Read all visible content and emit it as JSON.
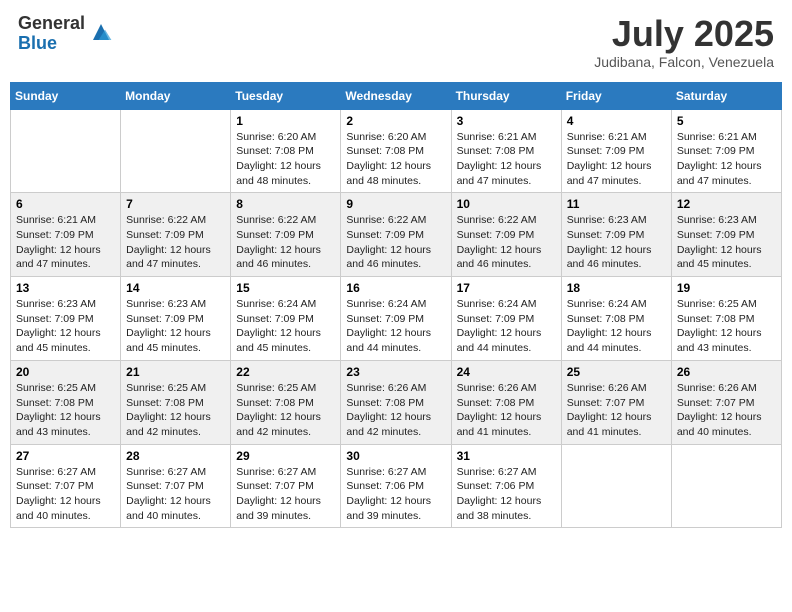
{
  "logo": {
    "general": "General",
    "blue": "Blue"
  },
  "header": {
    "title": "July 2025",
    "location": "Judibana, Falcon, Venezuela"
  },
  "days_of_week": [
    "Sunday",
    "Monday",
    "Tuesday",
    "Wednesday",
    "Thursday",
    "Friday",
    "Saturday"
  ],
  "weeks": [
    [
      {
        "day": "",
        "info": ""
      },
      {
        "day": "",
        "info": ""
      },
      {
        "day": "1",
        "info": "Sunrise: 6:20 AM\nSunset: 7:08 PM\nDaylight: 12 hours and 48 minutes."
      },
      {
        "day": "2",
        "info": "Sunrise: 6:20 AM\nSunset: 7:08 PM\nDaylight: 12 hours and 48 minutes."
      },
      {
        "day": "3",
        "info": "Sunrise: 6:21 AM\nSunset: 7:08 PM\nDaylight: 12 hours and 47 minutes."
      },
      {
        "day": "4",
        "info": "Sunrise: 6:21 AM\nSunset: 7:09 PM\nDaylight: 12 hours and 47 minutes."
      },
      {
        "day": "5",
        "info": "Sunrise: 6:21 AM\nSunset: 7:09 PM\nDaylight: 12 hours and 47 minutes."
      }
    ],
    [
      {
        "day": "6",
        "info": "Sunrise: 6:21 AM\nSunset: 7:09 PM\nDaylight: 12 hours and 47 minutes."
      },
      {
        "day": "7",
        "info": "Sunrise: 6:22 AM\nSunset: 7:09 PM\nDaylight: 12 hours and 47 minutes."
      },
      {
        "day": "8",
        "info": "Sunrise: 6:22 AM\nSunset: 7:09 PM\nDaylight: 12 hours and 46 minutes."
      },
      {
        "day": "9",
        "info": "Sunrise: 6:22 AM\nSunset: 7:09 PM\nDaylight: 12 hours and 46 minutes."
      },
      {
        "day": "10",
        "info": "Sunrise: 6:22 AM\nSunset: 7:09 PM\nDaylight: 12 hours and 46 minutes."
      },
      {
        "day": "11",
        "info": "Sunrise: 6:23 AM\nSunset: 7:09 PM\nDaylight: 12 hours and 46 minutes."
      },
      {
        "day": "12",
        "info": "Sunrise: 6:23 AM\nSunset: 7:09 PM\nDaylight: 12 hours and 45 minutes."
      }
    ],
    [
      {
        "day": "13",
        "info": "Sunrise: 6:23 AM\nSunset: 7:09 PM\nDaylight: 12 hours and 45 minutes."
      },
      {
        "day": "14",
        "info": "Sunrise: 6:23 AM\nSunset: 7:09 PM\nDaylight: 12 hours and 45 minutes."
      },
      {
        "day": "15",
        "info": "Sunrise: 6:24 AM\nSunset: 7:09 PM\nDaylight: 12 hours and 45 minutes."
      },
      {
        "day": "16",
        "info": "Sunrise: 6:24 AM\nSunset: 7:09 PM\nDaylight: 12 hours and 44 minutes."
      },
      {
        "day": "17",
        "info": "Sunrise: 6:24 AM\nSunset: 7:09 PM\nDaylight: 12 hours and 44 minutes."
      },
      {
        "day": "18",
        "info": "Sunrise: 6:24 AM\nSunset: 7:08 PM\nDaylight: 12 hours and 44 minutes."
      },
      {
        "day": "19",
        "info": "Sunrise: 6:25 AM\nSunset: 7:08 PM\nDaylight: 12 hours and 43 minutes."
      }
    ],
    [
      {
        "day": "20",
        "info": "Sunrise: 6:25 AM\nSunset: 7:08 PM\nDaylight: 12 hours and 43 minutes."
      },
      {
        "day": "21",
        "info": "Sunrise: 6:25 AM\nSunset: 7:08 PM\nDaylight: 12 hours and 42 minutes."
      },
      {
        "day": "22",
        "info": "Sunrise: 6:25 AM\nSunset: 7:08 PM\nDaylight: 12 hours and 42 minutes."
      },
      {
        "day": "23",
        "info": "Sunrise: 6:26 AM\nSunset: 7:08 PM\nDaylight: 12 hours and 42 minutes."
      },
      {
        "day": "24",
        "info": "Sunrise: 6:26 AM\nSunset: 7:08 PM\nDaylight: 12 hours and 41 minutes."
      },
      {
        "day": "25",
        "info": "Sunrise: 6:26 AM\nSunset: 7:07 PM\nDaylight: 12 hours and 41 minutes."
      },
      {
        "day": "26",
        "info": "Sunrise: 6:26 AM\nSunset: 7:07 PM\nDaylight: 12 hours and 40 minutes."
      }
    ],
    [
      {
        "day": "27",
        "info": "Sunrise: 6:27 AM\nSunset: 7:07 PM\nDaylight: 12 hours and 40 minutes."
      },
      {
        "day": "28",
        "info": "Sunrise: 6:27 AM\nSunset: 7:07 PM\nDaylight: 12 hours and 40 minutes."
      },
      {
        "day": "29",
        "info": "Sunrise: 6:27 AM\nSunset: 7:07 PM\nDaylight: 12 hours and 39 minutes."
      },
      {
        "day": "30",
        "info": "Sunrise: 6:27 AM\nSunset: 7:06 PM\nDaylight: 12 hours and 39 minutes."
      },
      {
        "day": "31",
        "info": "Sunrise: 6:27 AM\nSunset: 7:06 PM\nDaylight: 12 hours and 38 minutes."
      },
      {
        "day": "",
        "info": ""
      },
      {
        "day": "",
        "info": ""
      }
    ]
  ]
}
